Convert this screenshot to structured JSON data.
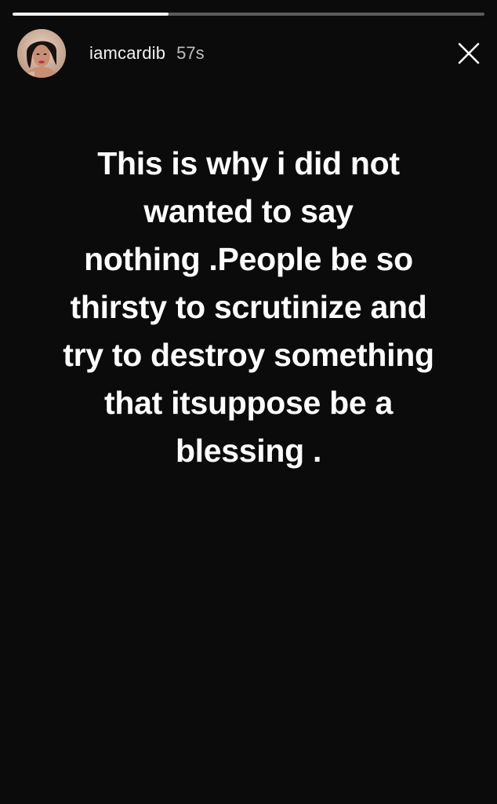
{
  "story": {
    "progress_fraction": 0.33,
    "username": "iamcardib",
    "timestamp": "57s",
    "text": "This is why i did not\nwanted to say\nnothing .People be so\nthirsty to scrutinize and\ntry to destroy something\nthat itsuppose be a\nblessing ."
  },
  "icons": {
    "close": "close-icon",
    "avatar": "profile-avatar"
  },
  "colors": {
    "background": "#0b0b0b",
    "text": "#ffffff",
    "progress_track": "#5b5b5b",
    "progress_fill": "#f0f0f0"
  }
}
